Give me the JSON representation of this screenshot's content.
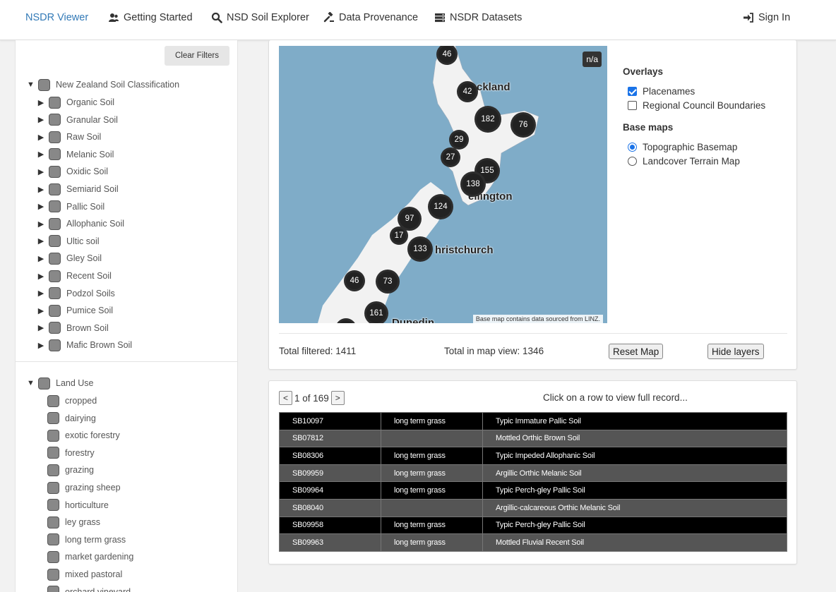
{
  "nav": {
    "brand": "NSDR Viewer",
    "items": [
      {
        "label": "Getting Started",
        "icon": "users-icon"
      },
      {
        "label": "NSD Soil Explorer",
        "icon": "search-icon"
      },
      {
        "label": "Data Provenance",
        "icon": "gavel-icon"
      },
      {
        "label": "NSDR Datasets",
        "icon": "server-icon"
      }
    ],
    "sign_in": "Sign In"
  },
  "sidebar": {
    "clear_filters": "Clear Filters",
    "soil_class_header": "New Zealand Soil Classification",
    "soil_classes": [
      "Organic Soil",
      "Granular Soil",
      "Raw Soil",
      "Melanic Soil",
      "Oxidic Soil",
      "Semiarid Soil",
      "Pallic Soil",
      "Allophanic Soil",
      "Ultic soil",
      "Gley Soil",
      "Recent Soil",
      "Podzol Soils",
      "Pumice Soil",
      "Brown Soil",
      "Mafic Brown Soil"
    ],
    "land_use_header": "Land Use",
    "land_uses": [
      "cropped",
      "dairying",
      "exotic forestry",
      "forestry",
      "grazing",
      "grazing sheep",
      "horticulture",
      "ley grass",
      "long term grass",
      "market gardening",
      "mixed pastoral",
      "orchard vineyard"
    ]
  },
  "map": {
    "na_badge": "n/a",
    "attribution": "Base map contains data sourced from LINZ.",
    "places": {
      "auckland": "ckland",
      "wellington": "ellington",
      "christchurch": "hristchurch",
      "dunedin": "Dunedin"
    },
    "clusters": [
      "46",
      "42",
      "182",
      "76",
      "29",
      "27",
      "155",
      "138",
      "124",
      "97",
      "17",
      "133",
      "46",
      "73",
      "161"
    ]
  },
  "controls": {
    "overlays_title": "Overlays",
    "placenames": "Placenames",
    "placenames_checked": true,
    "regional": "Regional Council Boundaries",
    "regional_checked": false,
    "basemaps_title": "Base maps",
    "topographic": "Topographic Basemap",
    "landcover": "Landcover Terrain Map",
    "selected_basemap": "Topographic Basemap"
  },
  "stats": {
    "total_filtered": "Total filtered: 1411",
    "total_in_view": "Total in map view: 1346",
    "reset_map": "Reset Map",
    "hide_layers": "Hide layers"
  },
  "table": {
    "prev": "<",
    "next": ">",
    "page_text": "1 of 169",
    "hint": "Click on a row to view full record...",
    "rows": [
      {
        "id": "SB10097",
        "land_use": "long term grass",
        "soil": "Typic Immature Pallic Soil"
      },
      {
        "id": "SB07812",
        "land_use": "",
        "soil": "Mottled Orthic Brown Soil"
      },
      {
        "id": "SB08306",
        "land_use": "long term grass",
        "soil": "Typic Impeded Allophanic Soil"
      },
      {
        "id": "SB09959",
        "land_use": "long term grass",
        "soil": "Argillic Orthic Melanic Soil"
      },
      {
        "id": "SB09964",
        "land_use": "long term grass",
        "soil": "Typic Perch-gley Pallic Soil"
      },
      {
        "id": "SB08040",
        "land_use": "",
        "soil": "Argillic-calcareous Orthic Melanic Soil"
      },
      {
        "id": "SB09958",
        "land_use": "long term grass",
        "soil": "Typic Perch-gley Pallic Soil"
      },
      {
        "id": "SB09963",
        "land_use": "long term grass",
        "soil": "Mottled Fluvial Recent Soil"
      }
    ]
  },
  "colors": {
    "brand": "#337ab7",
    "map_sea": "#7facc8",
    "land": "#f2f2f2",
    "cluster": "#222222",
    "accent": "#1a73e8"
  }
}
